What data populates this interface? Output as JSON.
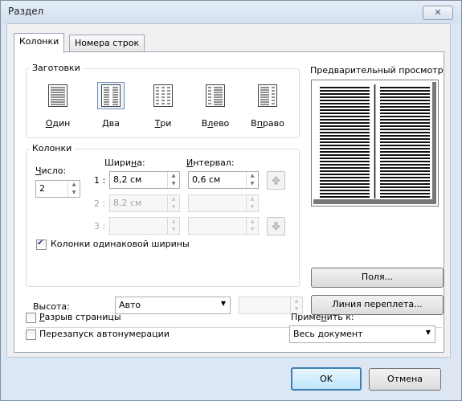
{
  "window": {
    "title": "Раздел",
    "close": "✕"
  },
  "tabs": [
    {
      "label": "Колонки",
      "active": true
    },
    {
      "label": "Номера строк",
      "active": false
    }
  ],
  "presets": {
    "title": "Заготовки",
    "items": [
      {
        "label": "Один",
        "icon": "one-column-icon"
      },
      {
        "label": "Два",
        "icon": "two-columns-icon",
        "selected": true
      },
      {
        "label": "Три",
        "icon": "three-columns-icon"
      },
      {
        "label": "Влево",
        "icon": "left-column-icon"
      },
      {
        "label": "Вправо",
        "icon": "right-column-icon"
      }
    ]
  },
  "columns": {
    "title": "Колонки",
    "count_label": "Число:",
    "count_value": "2",
    "width_label": "Ширина:",
    "spacing_label": "Интервал:",
    "rows": [
      {
        "index": "1 :",
        "width": "8,2 см",
        "spacing": "0,6 см",
        "enabled": true
      },
      {
        "index": "2 :",
        "width": "8,2 см",
        "spacing": "",
        "enabled": false
      },
      {
        "index": "3 :",
        "width": "",
        "spacing": "",
        "enabled": false
      }
    ],
    "equal_width_label": "Колонки одинаковой ширины",
    "equal_width_checked": true
  },
  "preview": {
    "title": "Предварительный просмотр"
  },
  "buttons": {
    "margins": "Поля...",
    "gutter": "Линия переплета...",
    "ok": "OK",
    "cancel": "Отмена"
  },
  "height": {
    "label": "Высота:",
    "value": "Авто",
    "amount": ""
  },
  "options": {
    "page_break": "Разрыв страницы",
    "page_break_checked": false,
    "restart_numbering": "Перезапуск автонумерации",
    "restart_numbering_checked": false
  },
  "apply_to": {
    "label": "Применить к:",
    "value": "Весь документ"
  },
  "colors": {
    "accent": "#3c7fb1",
    "title_bg": "#dce7f3"
  }
}
